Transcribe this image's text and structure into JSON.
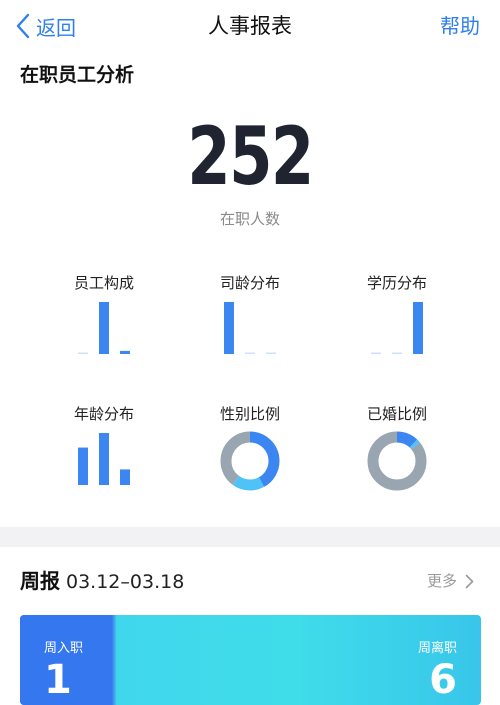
{
  "nav": {
    "back_label": "返回",
    "title": "人事报表",
    "help_label": "帮助"
  },
  "section": {
    "title": "在职员工分析"
  },
  "headcount": {
    "value": "252",
    "caption": "在职人数"
  },
  "cells": [
    {
      "label": "员工构成",
      "bars": [
        0.02,
        1.0,
        0.06
      ]
    },
    {
      "label": "司龄分布",
      "bars": [
        1.0,
        0.02,
        0.02
      ]
    },
    {
      "label": "学历分布",
      "bars": [
        0.02,
        0.02,
        1.0
      ]
    },
    {
      "label": "年龄分布",
      "bars": [
        0.72,
        1.0,
        0.3
      ]
    },
    {
      "label": "性别比例",
      "donut": [
        {
          "fraction": 0.42,
          "color": "#3b86f0"
        },
        {
          "fraction": 0.18,
          "color": "#4fc3f7"
        },
        {
          "fraction": 0.4,
          "color": "#9aa5b2"
        }
      ]
    },
    {
      "label": "已婚比例",
      "donut": [
        {
          "fraction": 0.12,
          "color": "#3b86f0"
        },
        {
          "fraction": 0.02,
          "color": "#4fc3f7"
        },
        {
          "fraction": 0.86,
          "color": "#9aa5b2"
        }
      ]
    }
  ],
  "weekly": {
    "label": "周报",
    "range": "03.12–03.18",
    "more_label": "更多"
  },
  "card": {
    "in_label": "周入职",
    "in_value": "1",
    "out_label": "周离职",
    "out_value": "6"
  },
  "colors": {
    "accent": "#2f80ed",
    "bar": "#3b86f0",
    "bar_faint": "#cfe0fb",
    "donut_gray": "#9aa5b2",
    "donut_light": "#4fc3f7"
  }
}
